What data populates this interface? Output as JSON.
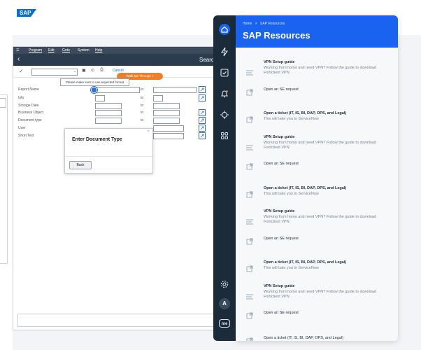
{
  "sap": {
    "menu": [
      "Program",
      "Edit",
      "Goto",
      "System",
      "Help"
    ],
    "title_partial": "Searc",
    "logo": "SAP",
    "toolbar": {
      "cancel_label": "Cancel",
      "walk_label": "Walk Me Through »"
    },
    "tooltip": "Please make sure to use expected format",
    "fields": [
      {
        "label": "Report Name",
        "to": "to"
      },
      {
        "label": "Info",
        "to": "to"
      },
      {
        "label": "Storage Date",
        "to": "to"
      },
      {
        "label": "Business Object",
        "to": "to"
      },
      {
        "label": "Document type",
        "to": "to"
      },
      {
        "label": "User",
        "to": ""
      },
      {
        "label": "Short Text",
        "to": ""
      }
    ],
    "dialog": {
      "title": "Enter Document Type",
      "back_label": "Back",
      "close_glyph": "×"
    }
  },
  "panel": {
    "breadcrumb_home": "Home",
    "breadcrumb_sep": ">",
    "breadcrumb_current": "SAP Resources",
    "title": "SAP Resources",
    "items": [
      {
        "kind": "vpn",
        "title": "VPN Setup guide",
        "desc": "Working from home and need VPN? Follow the guide to download Forticlient VPN"
      },
      {
        "kind": "link",
        "title": "Open an SE request",
        "desc": ""
      },
      {
        "kind": "link",
        "title": "Open a ticket (IT, IS, BI, DAP, OPS, and Legal)",
        "desc": "This will take you to ServiceNow"
      },
      {
        "kind": "vpn",
        "title": "VPN Setup guide",
        "desc": "Working from home and need VPN? Follow the guide to download Forticlient VPN"
      },
      {
        "kind": "link",
        "title": "Open an SE request",
        "desc": ""
      },
      {
        "kind": "link",
        "title": "Open a ticket (IT, IS, BI, DAP, OPS, and Legal)",
        "desc": "This will take you to ServiceNow"
      },
      {
        "kind": "vpn",
        "title": "VPN Setup guide",
        "desc": "Working from home and need VPN? Follow the guide to download Forticlient VPN"
      },
      {
        "kind": "link",
        "title": "Open an SE request",
        "desc": ""
      },
      {
        "kind": "link",
        "title": "Open a ticket (IT, IS, BI, DAP, OPS, and Legal)",
        "desc": "This will take you to ServiceNow"
      },
      {
        "kind": "vpn",
        "title": "VPN Setup guide",
        "desc": "Working from home and need VPN? Follow the guide to download Forticlient VPN"
      },
      {
        "kind": "link",
        "title": "Open an SE request",
        "desc": ""
      },
      {
        "kind": "link",
        "title": "Open a ticket (IT, IS, BI, DAP, OPS, and Legal)",
        "desc": ""
      }
    ]
  },
  "rail": {
    "icons": [
      "home-icon",
      "bolt-icon",
      "checklist-icon",
      "bell-icon",
      "hub-icon",
      "apps-grid-icon",
      "settings-icon"
    ],
    "avatar_letter": "A",
    "brand_badge": "me"
  },
  "colors": {
    "panel_header": "#1a63f0",
    "rail": "#1c2b3a",
    "walk_button": "#f07d28",
    "sap_title": "#2d3b4e"
  }
}
